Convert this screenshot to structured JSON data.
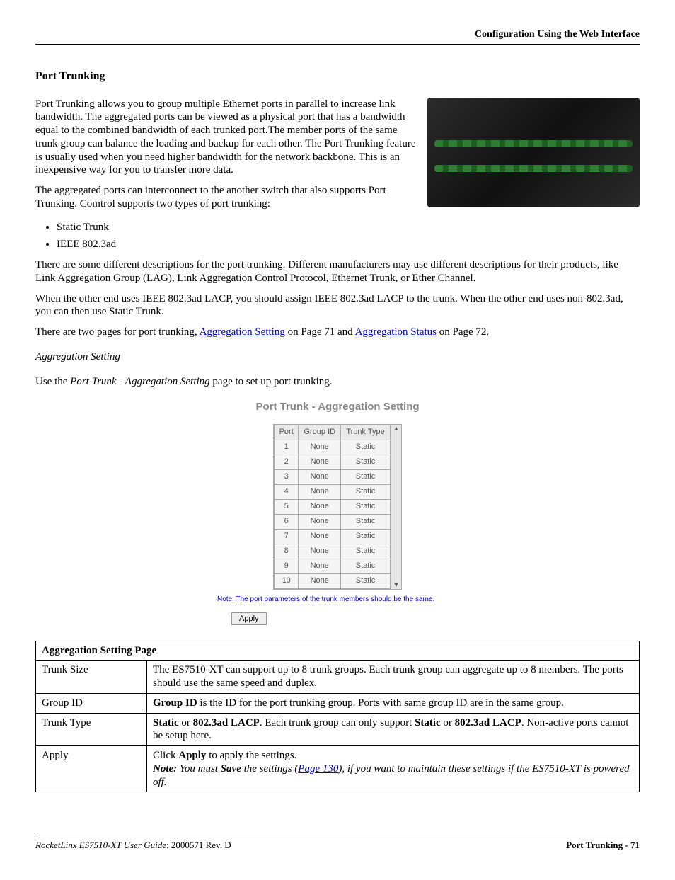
{
  "header": {
    "right": "Configuration Using the Web Interface"
  },
  "section": {
    "title": "Port Trunking",
    "intro_p1": "Port Trunking allows you to group multiple Ethernet ports in parallel to increase link bandwidth. The aggregated ports can be viewed as a physical port that has a bandwidth equal to the combined bandwidth of each trunked port.The member ports of the same trunk group can balance the loading and backup for each other. The Port Trunking feature is usually used when you need higher bandwidth for the network backbone. This is an inexpensive way for you to transfer more data.",
    "intro_p2": "The aggregated ports can interconnect to the another switch that also supports Port Trunking. Comtrol supports two types of port trunking:",
    "bullets": [
      "Static Trunk",
      "IEEE 802.3ad"
    ],
    "desc_p1": "There are some different descriptions for the port trunking. Different manufacturers may use different descriptions for their products, like Link Aggregation Group (LAG), Link Aggregation Control Protocol, Ethernet Trunk, or Ether Channel.",
    "desc_p2": "When the other end uses IEEE 802.3ad LACP, you should assign IEEE 802.3ad LACP to the trunk. When the other end uses non-802.3ad, you can then use Static Trunk.",
    "pages_line_pre": "There are two pages for port trunking, ",
    "link1": "Aggregation Setting",
    "pages_line_mid": " on Page 71 and ",
    "link2": "Aggregation Status",
    "pages_line_post": " on Page 72."
  },
  "subsection": {
    "title": "Aggregation Setting",
    "use_line_pre": "Use the ",
    "use_line_em": "Port Trunk - Aggregation Setting",
    "use_line_post": " page to set up port trunking."
  },
  "ui": {
    "title": "Port Trunk - Aggregation Setting",
    "cols": [
      "Port",
      "Group ID",
      "Trunk Type"
    ],
    "rows": [
      {
        "port": "1",
        "group": "None",
        "type": "Static"
      },
      {
        "port": "2",
        "group": "None",
        "type": "Static"
      },
      {
        "port": "3",
        "group": "None",
        "type": "Static"
      },
      {
        "port": "4",
        "group": "None",
        "type": "Static"
      },
      {
        "port": "5",
        "group": "None",
        "type": "Static"
      },
      {
        "port": "6",
        "group": "None",
        "type": "Static"
      },
      {
        "port": "7",
        "group": "None",
        "type": "Static"
      },
      {
        "port": "8",
        "group": "None",
        "type": "Static"
      },
      {
        "port": "9",
        "group": "None",
        "type": "Static"
      },
      {
        "port": "10",
        "group": "None",
        "type": "Static"
      }
    ],
    "note": "Note: The port parameters of the trunk members should be the same.",
    "apply": "Apply"
  },
  "doc_table": {
    "header": "Aggregation Setting Page",
    "rows": [
      {
        "k": "Trunk Size",
        "v_plain": "The ES7510-XT can support up to 8 trunk groups. Each trunk group can aggregate up to 8 members. The ports should use the same speed and duplex."
      },
      {
        "k": "Group ID",
        "v_html": "<b>Group ID</b> is the ID for the port trunking group. Ports with same group ID are in the same group."
      },
      {
        "k": "Trunk Type",
        "v_html": "<b>Static</b> or <b>802.3ad LACP</b>. Each trunk group can only support <b>Static</b> or <b>802.3ad LACP</b>. Non-active ports cannot be setup here."
      },
      {
        "k": "Apply",
        "v_html": "Click <b>Apply</b> to apply the settings.<br><b><i>Note:</i></b> <i>You must <b>Save</b> the settings (<a class='doclink' href='#' data-name='page-130-link' data-interactable='true'>Page 130</a>), if you want to maintain these settings if the ES7510-XT is powered off.</i>"
      }
    ]
  },
  "footer": {
    "left_em": "RocketLinx ES7510-XT  User Guide",
    "left_rev": ": 2000571 Rev. D",
    "right": "Port Trunking - 71"
  }
}
